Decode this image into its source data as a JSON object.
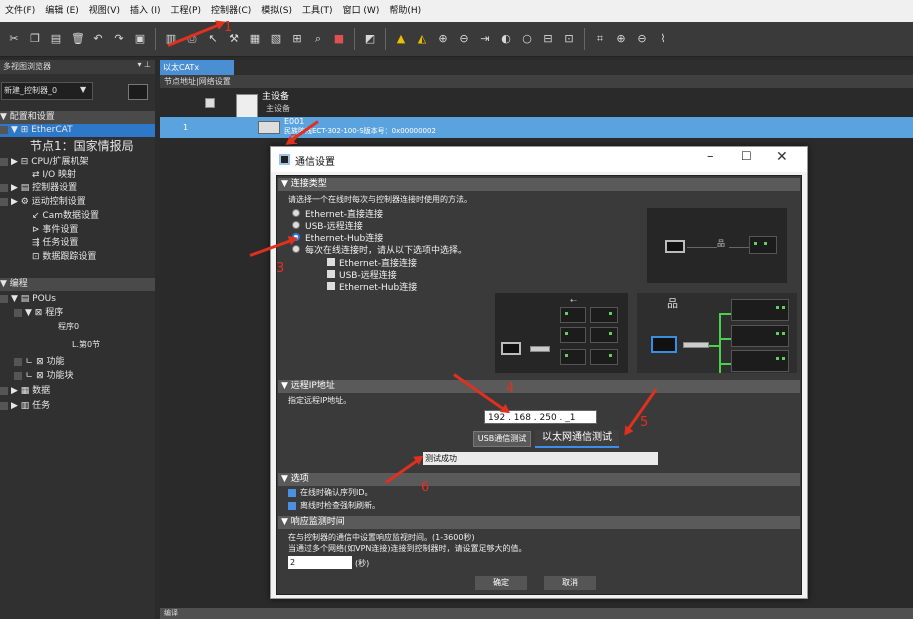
{
  "menu": [
    "文件(F)",
    "编辑 (E)",
    "视图(V)",
    "插入 (I)",
    "工程(P)",
    "控制器(C)",
    "模拟(S)",
    "工具(T)",
    "窗口 (W)",
    "帮助(H)"
  ],
  "left_panel": {
    "title": "多视图浏览器",
    "pin": "▾ ⊥",
    "controller_select": "新建_控制器_0",
    "tree": [
      {
        "label": "配置和设置",
        "type": "header"
      },
      {
        "label": "EtherCAT",
        "type": "selected"
      },
      {
        "label": "节点1：国家情报局",
        "type": "large"
      },
      {
        "label": "CPU/扩展机架"
      },
      {
        "label": "I/O 映射"
      },
      {
        "label": "控制器设置"
      },
      {
        "label": "运动控制设置"
      },
      {
        "label": "Cam数据设置"
      },
      {
        "label": "事件设置"
      },
      {
        "label": "任务设置"
      },
      {
        "label": "数据跟踪设置"
      },
      {
        "label": "编程",
        "type": "header"
      },
      {
        "label": "POUs"
      },
      {
        "label": "程序"
      },
      {
        "label": "程序0"
      },
      {
        "label": "L.第0节"
      },
      {
        "label": "功能"
      },
      {
        "label": "功能块"
      },
      {
        "label": "数据"
      },
      {
        "label": "任务"
      }
    ]
  },
  "editor": {
    "tab": "以太CATx",
    "subtab": "节点地址|网络设置",
    "master_label": "主设备",
    "master_sub": "主设备",
    "row_number": "1",
    "slave_name": "E001",
    "slave_desc": "民族阵线ECT-302-100-S版本号：0x00000002",
    "bottom": "编译"
  },
  "dialog": {
    "title": "通信设置",
    "sections": {
      "conn_type": "▼ 连接类型",
      "remote_ip": "▼ 远程IP地址",
      "options": "▼ 选项",
      "monitor": "▼ 响应监测时间"
    },
    "conn_desc": "请选择一个在线时每次与控制器连接时使用的方法。",
    "radios": [
      {
        "label": "Ethernet-直接连接",
        "selected": false
      },
      {
        "label": "USB-远程连接",
        "selected": false
      },
      {
        "label": "Ethernet-Hub连接",
        "selected": true
      },
      {
        "label": "每次在线连接时，请从以下选项中选择。",
        "selected": false
      }
    ],
    "sub_options": [
      "Ethernet-直接连接",
      "USB-远程连接",
      "Ethernet-Hub连接"
    ],
    "ip_desc": "指定远程IP地址。",
    "ip_value": "192 . 168 . 250 . _1",
    "usb_test_button": "USB通信测试",
    "eth_test_button": "以太网通信测试",
    "test_result": "测试成功",
    "checkboxes": [
      "在线时确认序列ID。",
      "离线时检查强制刷新。"
    ],
    "monitor_line1": "在与控制器的通信中设置响应监视时间。(1-3600秒)",
    "monitor_line2": "当通过多个网络(如VPN连接)连接到控制器时，请设置足够大的值。",
    "monitor_value": "2",
    "monitor_unit": "(秒)",
    "ok_button": "确定",
    "cancel_button": "取消",
    "window_controls": [
      "–",
      "☐",
      "✕"
    ]
  },
  "annotations": [
    "1",
    "2",
    "3",
    "4",
    "5",
    "6"
  ],
  "colors": {
    "accent": "#2d78c8",
    "annotation": "#e03020",
    "success_green": "#4ccf4c"
  }
}
